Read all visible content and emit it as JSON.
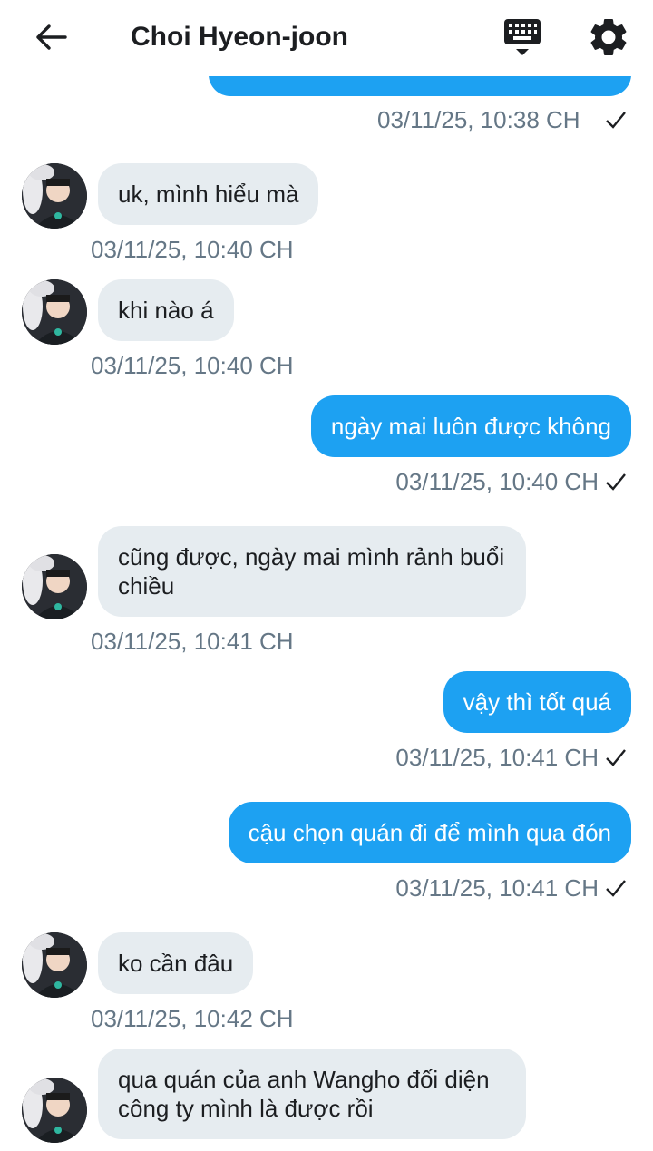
{
  "header": {
    "title": "Choi Hyeon-joon",
    "back_icon": "arrow-left-icon",
    "keyboard_icon": "keyboard-icon",
    "settings_icon": "gear-icon"
  },
  "colors": {
    "outgoing_bubble": "#1da1f2",
    "incoming_bubble": "#e6ecf0",
    "timestamp": "#657786"
  },
  "messages": [
    {
      "direction": "out",
      "text": "",
      "time": "03/11/25, 10:38 CH",
      "status": "sent"
    },
    {
      "direction": "in",
      "text": "uk, mình hiểu mà",
      "time": "03/11/25, 10:40 CH"
    },
    {
      "direction": "in",
      "text": "khi nào á",
      "time": "03/11/25, 10:40 CH"
    },
    {
      "direction": "out",
      "text": "ngày mai luôn được không",
      "time": "03/11/25, 10:40 CH",
      "status": "sent"
    },
    {
      "direction": "in",
      "text": "cũng được, ngày mai mình rảnh buổi chiều",
      "time": "03/11/25, 10:41 CH"
    },
    {
      "direction": "out",
      "text": "vậy thì tốt quá",
      "time": "03/11/25, 10:41 CH",
      "status": "sent"
    },
    {
      "direction": "out",
      "text": "cậu chọn quán đi để mình qua đón",
      "time": "03/11/25, 10:41 CH",
      "status": "sent"
    },
    {
      "direction": "in",
      "text": "ko cần đâu",
      "time": "03/11/25, 10:42 CH"
    },
    {
      "direction": "in",
      "text": "qua quán của anh Wangho đối diện công ty mình là được rồi",
      "time": ""
    }
  ]
}
